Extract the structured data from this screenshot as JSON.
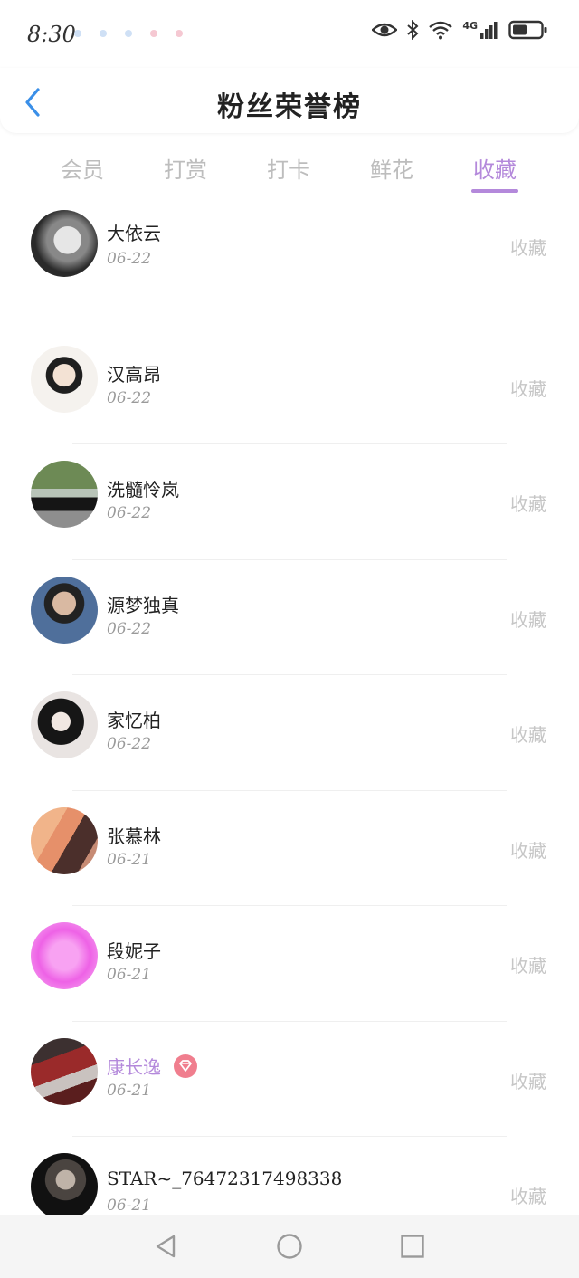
{
  "status_bar": {
    "time": "8:30",
    "network": "4G",
    "icons": [
      "notification-dot",
      "eye-icon",
      "bluetooth-icon",
      "wifi-icon",
      "signal-icon",
      "battery-icon"
    ]
  },
  "header": {
    "title": "粉丝荣誉榜",
    "back_icon": "chevron-left-icon"
  },
  "tabs": [
    {
      "label": "会员",
      "active": false
    },
    {
      "label": "打赏",
      "active": false
    },
    {
      "label": "打卡",
      "active": false
    },
    {
      "label": "鲜花",
      "active": false
    },
    {
      "label": "收藏",
      "active": true
    }
  ],
  "list": [
    {
      "name": "大依云",
      "date": "06-22",
      "action": "收藏",
      "vip": false
    },
    {
      "name": "汉高昂",
      "date": "06-22",
      "action": "收藏",
      "vip": false
    },
    {
      "name": "洗髓怜岚",
      "date": "06-22",
      "action": "收藏",
      "vip": false
    },
    {
      "name": "源梦独真",
      "date": "06-22",
      "action": "收藏",
      "vip": false
    },
    {
      "name": "家忆柏",
      "date": "06-22",
      "action": "收藏",
      "vip": false
    },
    {
      "name": "张慕林",
      "date": "06-21",
      "action": "收藏",
      "vip": false
    },
    {
      "name": "段妮子",
      "date": "06-21",
      "action": "收藏",
      "vip": false
    },
    {
      "name": "康长逸",
      "date": "06-21",
      "action": "收藏",
      "vip": true
    },
    {
      "name": "STAR~_76472317498338",
      "date": "06-21",
      "action": "收藏",
      "vip": false
    }
  ],
  "nav_bar": {
    "icons": [
      "back-triangle-icon",
      "home-circle-icon",
      "recents-square-icon"
    ]
  },
  "colors": {
    "accent": "#b489db",
    "back_arrow": "#3a8fe8",
    "muted": "#c6c6c6",
    "vip_badge": "#f07e8e"
  }
}
